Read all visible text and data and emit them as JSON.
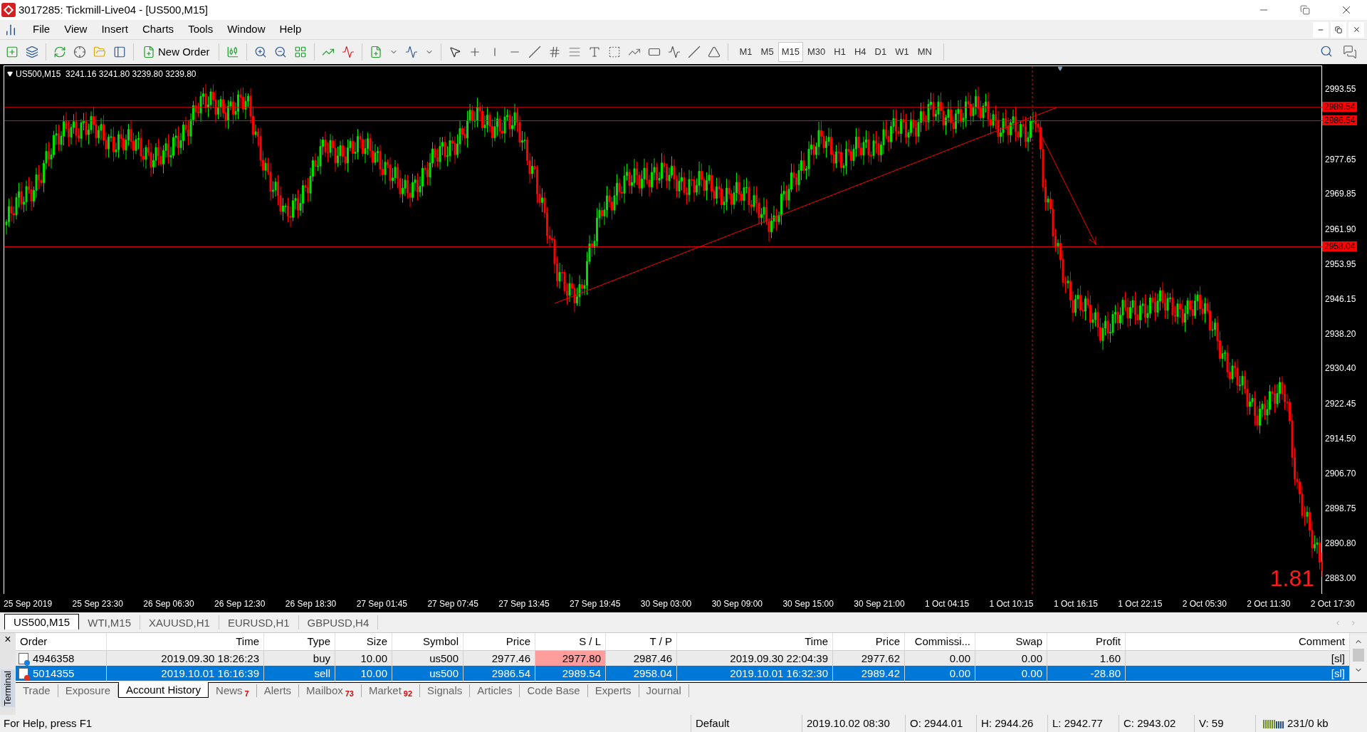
{
  "window": {
    "title": "3017285: Tickmill-Live04 - [US500,M15]"
  },
  "menu": [
    "File",
    "View",
    "Insert",
    "Charts",
    "Tools",
    "Window",
    "Help"
  ],
  "toolbar": {
    "new_order": "New Order",
    "timeframes": [
      {
        "label": "M1",
        "selected": false
      },
      {
        "label": "M5",
        "selected": false
      },
      {
        "label": "M15",
        "selected": true
      },
      {
        "label": "M30",
        "selected": false
      },
      {
        "label": "H1",
        "selected": false
      },
      {
        "label": "H4",
        "selected": false
      },
      {
        "label": "D1",
        "selected": false
      },
      {
        "label": "W1",
        "selected": false
      },
      {
        "label": "MN",
        "selected": false
      }
    ]
  },
  "chart": {
    "header": "US500,M15  3241.16 3241.80 3239.80 3239.80",
    "price_ticks": [
      "2993.55",
      "2977.65",
      "2969.85",
      "2961.90",
      "2953.95",
      "2946.15",
      "2938.20",
      "2930.40",
      "2922.45",
      "2914.50",
      "2906.70",
      "2898.75",
      "2890.80",
      "2883.00"
    ],
    "price_lines": [
      {
        "label": "2989.54"
      },
      {
        "label": "2986.54"
      },
      {
        "label": "2958.04"
      }
    ],
    "time_ticks": [
      "25 Sep 2019",
      "25 Sep 23:30",
      "26 Sep 06:30",
      "26 Sep 12:30",
      "26 Sep 18:30",
      "27 Sep 01:45",
      "27 Sep 07:45",
      "27 Sep 13:45",
      "27 Sep 19:45",
      "30 Sep 03:00",
      "30 Sep 09:00",
      "30 Sep 15:00",
      "30 Sep 21:00",
      "1 Oct 04:15",
      "1 Oct 10:15",
      "1 Oct 16:15",
      "1 Oct 22:15",
      "2 Oct 05:30",
      "2 Oct 11:30",
      "2 Oct 17:30"
    ],
    "corner_value": "1.81"
  },
  "chart_tabs": [
    {
      "label": "US500,M15",
      "selected": true
    },
    {
      "label": "WTI,M15",
      "selected": false
    },
    {
      "label": "XAUUSD,H1",
      "selected": false
    },
    {
      "label": "EURUSD,H1",
      "selected": false
    },
    {
      "label": "GBPUSD,H4",
      "selected": false
    }
  ],
  "terminal": {
    "label": "Terminal",
    "close": "×",
    "columns": [
      "Order",
      "Time",
      "Type",
      "Size",
      "Symbol",
      "Price",
      "S / L",
      "T / P",
      "Time",
      "Price",
      "Commissi...",
      "Swap",
      "Profit",
      "Comment"
    ],
    "rows": [
      {
        "kind": "buy",
        "selected": false,
        "sl_highlight": true,
        "cells": [
          "4946358",
          "2019.09.30 18:26:23",
          "buy",
          "10.00",
          "us500",
          "2977.46",
          "2977.80",
          "2987.46",
          "2019.09.30 22:04:39",
          "2977.62",
          "0.00",
          "0.00",
          "1.60",
          "[sl]"
        ]
      },
      {
        "kind": "sell",
        "selected": true,
        "sl_highlight": false,
        "cells": [
          "5014355",
          "2019.10.01 16:16:39",
          "sell",
          "10.00",
          "us500",
          "2986.54",
          "2989.54",
          "2958.04",
          "2019.10.01 16:32:30",
          "2989.42",
          "0.00",
          "0.00",
          "-28.80",
          "[sl]"
        ]
      }
    ],
    "tabs": [
      {
        "label": "Trade",
        "selected": false
      },
      {
        "label": "Exposure",
        "selected": false
      },
      {
        "label": "Account History",
        "selected": true
      },
      {
        "label": "News",
        "badge": "7",
        "selected": false
      },
      {
        "label": "Alerts",
        "selected": false
      },
      {
        "label": "Mailbox",
        "badge": "73",
        "selected": false
      },
      {
        "label": "Market",
        "badge": "92",
        "selected": false
      },
      {
        "label": "Signals",
        "selected": false
      },
      {
        "label": "Articles",
        "selected": false
      },
      {
        "label": "Code Base",
        "selected": false
      },
      {
        "label": "Experts",
        "selected": false
      },
      {
        "label": "Journal",
        "selected": false
      }
    ]
  },
  "status_bar": [
    "For Help, press F1",
    "Default",
    "2019.10.02 08:30",
    "O: 2944.01",
    "H: 2944.26",
    "L: 2942.77",
    "C: 2943.02",
    "V: 59",
    "231/0 kb"
  ]
}
